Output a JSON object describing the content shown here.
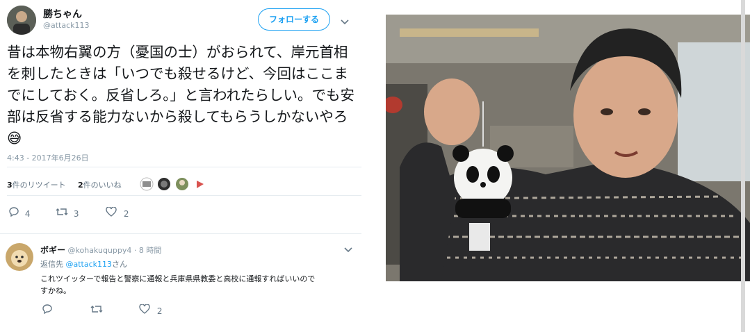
{
  "tweet": {
    "display_name": "勝ちゃん",
    "handle": "@attack113",
    "follow_label": "フォローする",
    "text": "昔は本物右翼の方（憂国の士）がおられて、岸元首相を刺したときは「いつでも殺せるけど、今回はここまでにしておく。反省しろ。」と言われたらしい。でも安部は反省する能力ないから殺してもらうしかないやろ😅",
    "timestamp": "4:43 - 2017年6月26日",
    "retweet_count": "3",
    "retweet_label": "件のリツイート",
    "like_count": "2",
    "like_label": "件のいいね",
    "actions": {
      "reply": "4",
      "retweet": "3",
      "like": "2"
    }
  },
  "reply": {
    "display_name": "ボギー",
    "handle": "@kohakuquppy4",
    "time": "· 8 時間",
    "reply_to_prefix": "返信先",
    "reply_to_handle": "@attack113",
    "reply_to_suffix": "さん",
    "text_line1": "これツイッターで報告と警察に通報と兵庫県県教委と高校に通報すればいいので",
    "text_line2": "すかね。",
    "actions": {
      "reply": "",
      "retweet": "",
      "like": "2"
    }
  },
  "colors": {
    "twitter_blue": "#1da1f2",
    "muted": "#8899a6"
  }
}
